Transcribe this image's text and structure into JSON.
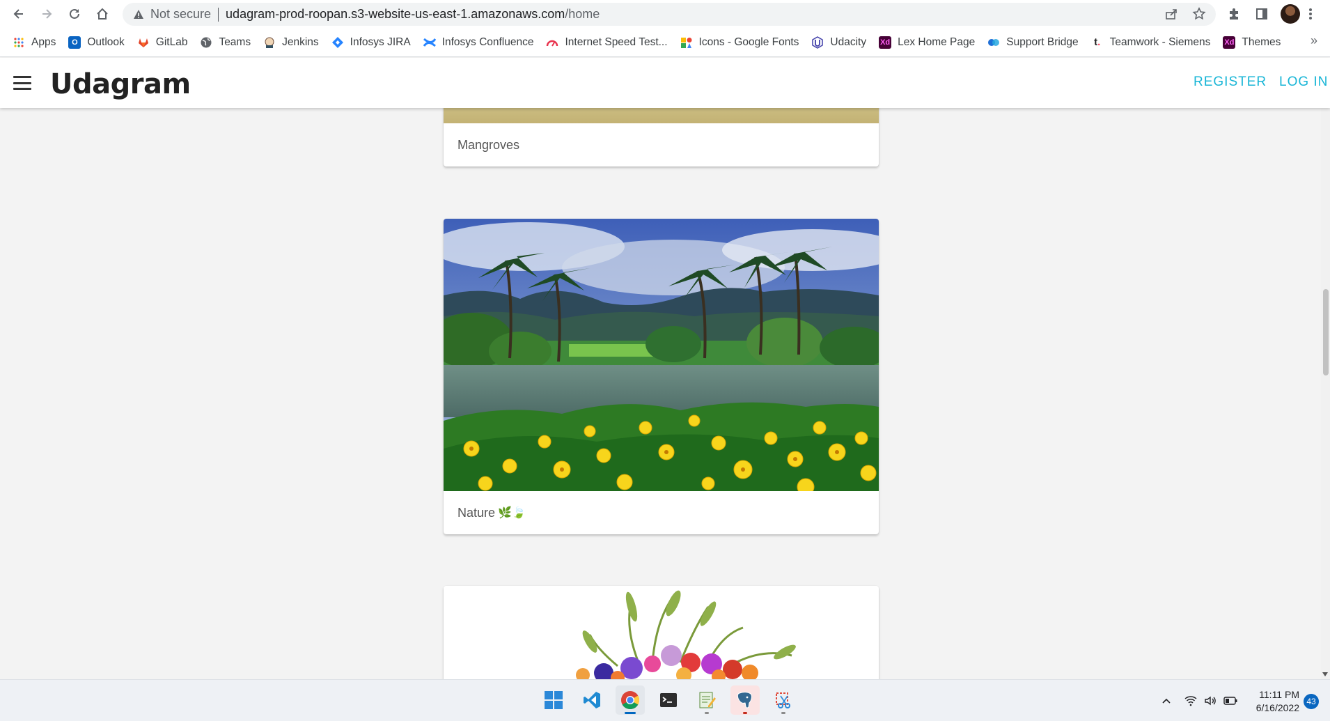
{
  "browser": {
    "security_label": "Not secure",
    "url_host": "udagram-prod-roopan.s3-website-us-east-1.amazonaws.com",
    "url_path": "/home",
    "more_bookmarks": "»"
  },
  "bookmarks": [
    {
      "label": "Apps",
      "icon": "apps-grid-icon"
    },
    {
      "label": "Outlook",
      "icon": "outlook-icon"
    },
    {
      "label": "GitLab",
      "icon": "gitlab-icon"
    },
    {
      "label": "Teams",
      "icon": "globe-icon"
    },
    {
      "label": "Jenkins",
      "icon": "jenkins-icon"
    },
    {
      "label": "Infosys JIRA",
      "icon": "jira-icon"
    },
    {
      "label": "Infosys Confluence",
      "icon": "confluence-icon"
    },
    {
      "label": "Internet Speed Test...",
      "icon": "speedtest-icon"
    },
    {
      "label": "Icons - Google Fonts",
      "icon": "google-fonts-icon"
    },
    {
      "label": "Udacity",
      "icon": "udacity-icon"
    },
    {
      "label": "Lex Home Page",
      "icon": "xd-icon"
    },
    {
      "label": "Support Bridge",
      "icon": "support-bridge-icon"
    },
    {
      "label": "Teamwork - Siemens",
      "icon": "teamwork-icon"
    },
    {
      "label": "Themes",
      "icon": "xd-icon"
    }
  ],
  "app": {
    "title": "Udagram",
    "register_label": "REGISTER",
    "login_label": "LOG IN",
    "accent_color": "#17b5d6"
  },
  "feed": [
    {
      "caption": "Mangroves",
      "emoji": ""
    },
    {
      "caption": "Nature",
      "emoji": "🌿🍃"
    },
    {
      "caption": "",
      "emoji": ""
    }
  ],
  "taskbar": {
    "time": "11:11 PM",
    "date": "6/16/2022",
    "notification_count": "43"
  }
}
